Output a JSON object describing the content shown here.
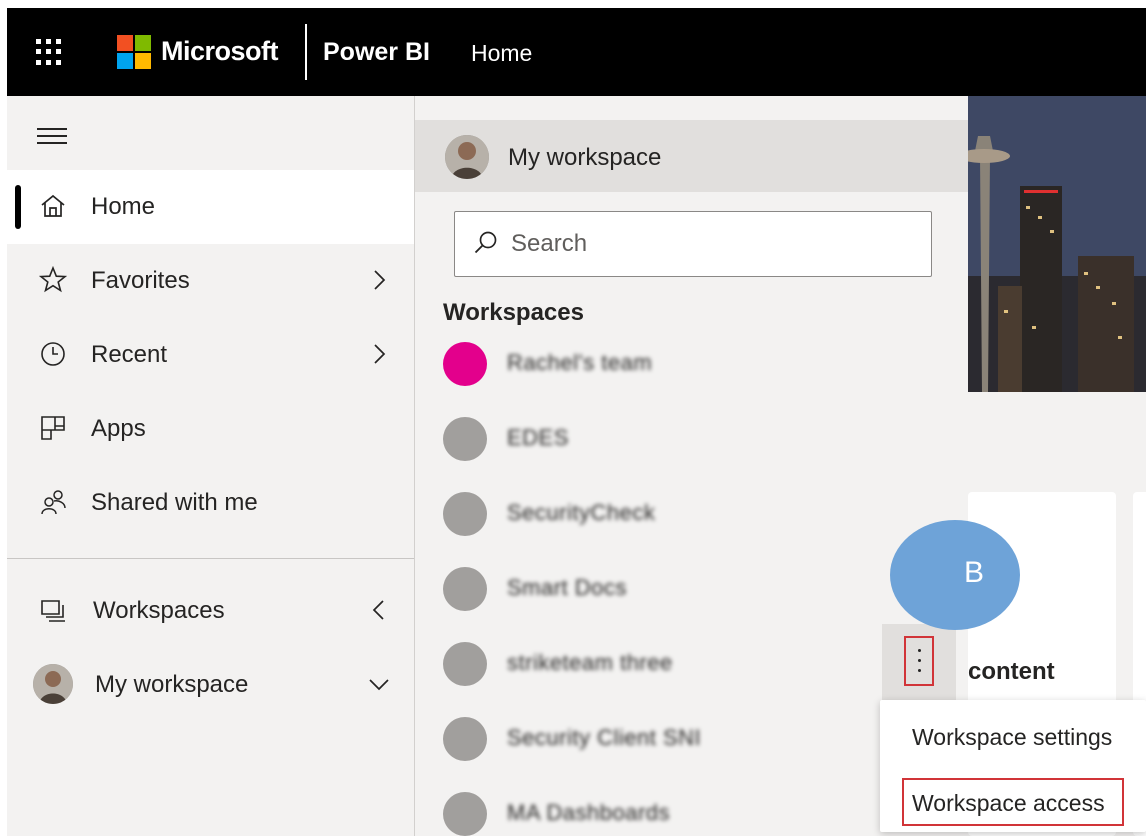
{
  "topbar": {
    "brand": "Microsoft",
    "app_name": "Power BI",
    "breadcrumb": "Home",
    "logo_colors": [
      "#f25022",
      "#7fba00",
      "#00a4ef",
      "#ffb900"
    ]
  },
  "leftnav": {
    "items": [
      {
        "label": "Home",
        "icon": "home-icon",
        "active": true
      },
      {
        "label": "Favorites",
        "icon": "star-icon",
        "chevron": "right"
      },
      {
        "label": "Recent",
        "icon": "clock-icon",
        "chevron": "right"
      },
      {
        "label": "Apps",
        "icon": "apps-icon"
      },
      {
        "label": "Shared with me",
        "icon": "shared-icon"
      },
      {
        "label": "Workspaces",
        "icon": "workspaces-icon",
        "chevron": "left"
      },
      {
        "label": "My workspace",
        "icon": "avatar",
        "chevron": "down"
      }
    ]
  },
  "flyout": {
    "my_workspace": "My workspace",
    "search_placeholder": "Search",
    "heading": "Workspaces",
    "workspaces": [
      {
        "name": "Rachel's team",
        "color": "#e3008c"
      },
      {
        "name": "EDES",
        "color": "#a19f9d"
      },
      {
        "name": "SecurityCheck",
        "color": "#a19f9d"
      },
      {
        "name": "Smart Docs",
        "color": "#a19f9d"
      },
      {
        "name": "striketeam three",
        "color": "#a19f9d"
      },
      {
        "name": "Security Client SNI",
        "color": "#a19f9d"
      },
      {
        "name": "MA Dashboards",
        "color": "#a19f9d"
      }
    ]
  },
  "content": {
    "card_letter": "B",
    "card_title": "content"
  },
  "context_menu": {
    "items": [
      "Workspace settings",
      "Workspace access"
    ],
    "highlight_color": "#d13438"
  }
}
